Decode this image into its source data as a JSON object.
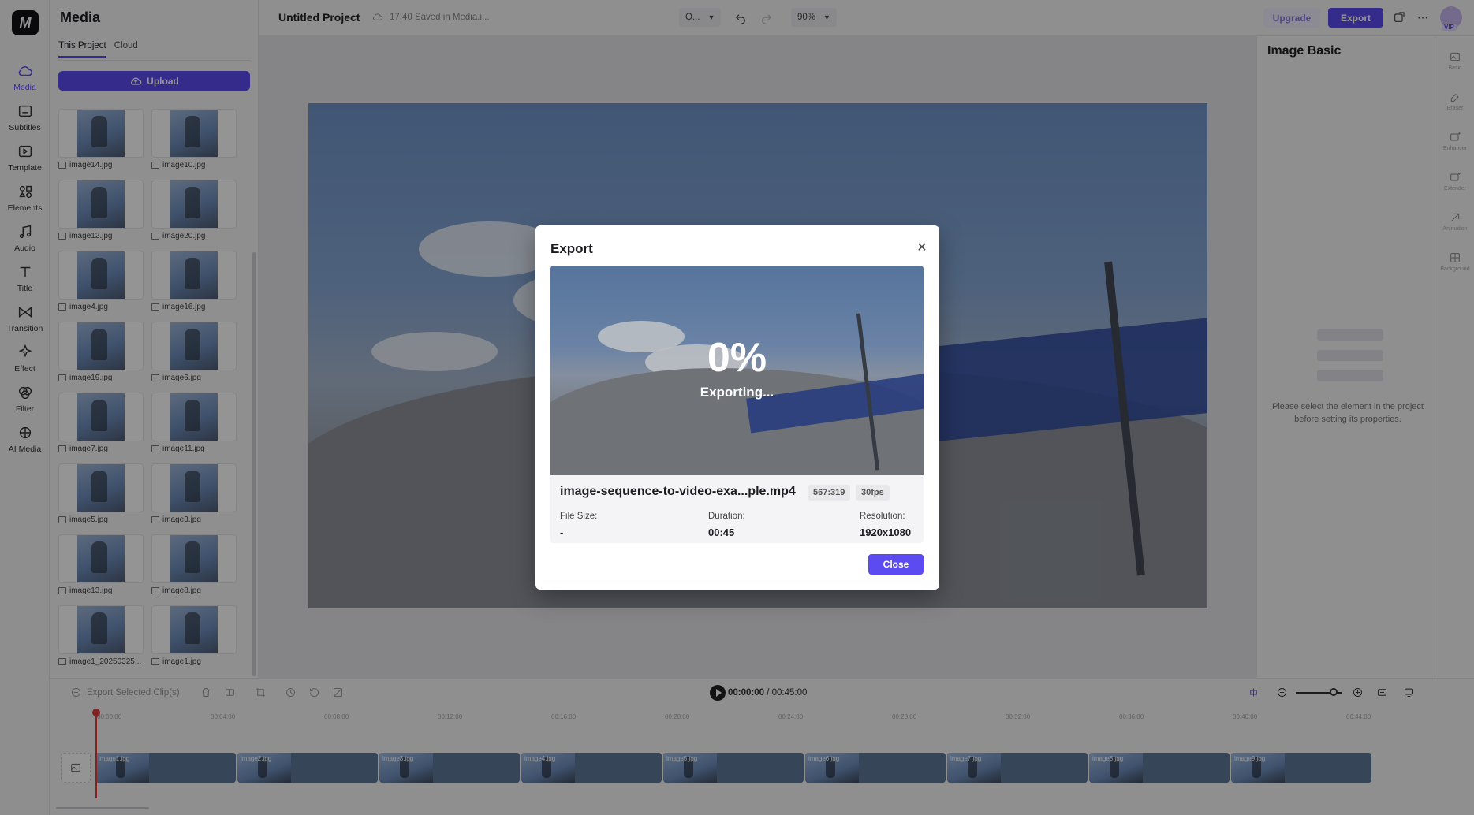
{
  "app": {
    "logo_letter": "M"
  },
  "rail": [
    {
      "label": "Media",
      "icon": "cloud-icon",
      "active": true
    },
    {
      "label": "Subtitles",
      "icon": "subtitles-icon"
    },
    {
      "label": "Template",
      "icon": "template-icon"
    },
    {
      "label": "Elements",
      "icon": "elements-icon"
    },
    {
      "label": "Audio",
      "icon": "music-note-icon"
    },
    {
      "label": "Title",
      "icon": "text-icon"
    },
    {
      "label": "Transition",
      "icon": "transition-icon"
    },
    {
      "label": "Effect",
      "icon": "effect-icon"
    },
    {
      "label": "Filter",
      "icon": "filter-icon"
    },
    {
      "label": "AI Media",
      "icon": "ai-media-icon"
    }
  ],
  "media_panel": {
    "title": "Media",
    "tabs": [
      "This Project",
      "Cloud"
    ],
    "upload_label": "Upload",
    "items": [
      "image14.jpg",
      "image10.jpg",
      "image12.jpg",
      "image20.jpg",
      "image4.jpg",
      "image16.jpg",
      "image19.jpg",
      "image6.jpg",
      "image7.jpg",
      "image11.jpg",
      "image5.jpg",
      "image3.jpg",
      "image13.jpg",
      "image8.jpg",
      "image1_20250325...",
      "image1.jpg"
    ]
  },
  "topbar": {
    "project_title": "Untitled Project",
    "saved_status": "17:40 Saved in Media.i...",
    "ratio_value": "O...",
    "zoom_value": "90%",
    "upgrade_label": "Upgrade",
    "export_label": "Export",
    "vip_label": "VIP"
  },
  "properties": {
    "title": "Image Basic",
    "message": "Please select the element in the project before setting its properties.",
    "rail": [
      "Basic",
      "Eraser",
      "Enhancer",
      "Extender",
      "Animation",
      "Background"
    ]
  },
  "timeline": {
    "export_selected_label": "Export Selected Clip(s)",
    "current_time": "00:00:00",
    "total_time": "00:45:00",
    "ruler": [
      "00:00:00",
      "00:04:00",
      "00:08:00",
      "00:12:00",
      "00:16:00",
      "00:20:00",
      "00:24:00",
      "00:28:00",
      "00:32:00",
      "00:36:00",
      "00:40:00",
      "00:44:00"
    ],
    "clips": [
      "image1.jpg",
      "image2.jpg",
      "image3.jpg",
      "image4.jpg",
      "image5.jpg",
      "image6.jpg",
      "image7.jpg",
      "image8.jpg",
      "image9.jpg"
    ]
  },
  "export_dialog": {
    "title": "Export",
    "progress_text": "0%",
    "status_text": "Exporting...",
    "file_name": "image-sequence-to-video-exa...ple.mp4",
    "aspect_chip": "567:319",
    "fps_chip": "30fps",
    "file_size_label": "File Size:",
    "file_size_value": "-",
    "duration_label": "Duration:",
    "duration_value": "00:45",
    "resolution_label": "Resolution:",
    "resolution_value": "1920x1080",
    "close_label": "Close"
  },
  "colors": {
    "accent": "#5b4bf0",
    "overlay": "rgba(0,0,0,0.42)",
    "playhead": "#e23b3b"
  }
}
